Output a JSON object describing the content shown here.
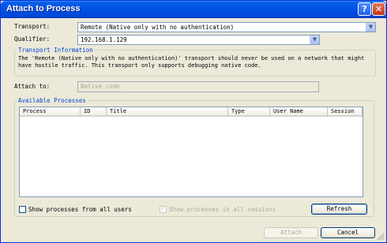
{
  "window": {
    "title": "Attach to Process",
    "help_label": "?",
    "close_label": "✕"
  },
  "transport": {
    "label": "Transport:",
    "value": "Remote (Native only with no authentication)"
  },
  "qualifier": {
    "label": "Qualifier:",
    "value": "192.168.1.129"
  },
  "transport_info": {
    "title": "Transport Information",
    "text_line1": "The 'Remote (Native only with no authentication)' transport should never be used on a network that might",
    "text_line2": "have hostile traffic. This transport only supports debugging native code."
  },
  "attach_to": {
    "label": "Attach to:",
    "value": "Native code"
  },
  "available_processes": {
    "title": "Available Processes",
    "columns": [
      "Process",
      "ID",
      "Title",
      "Type",
      "User Name",
      "Session"
    ]
  },
  "options": {
    "show_all_users": "Show processes from all users",
    "show_all_sessions": "Show processes in all sessions"
  },
  "buttons": {
    "refresh": "Refresh",
    "attach": "Attach",
    "cancel": "Cancel"
  },
  "icons": {
    "dropdown": "chevron-down-icon",
    "help": "help-icon",
    "close": "close-icon"
  }
}
